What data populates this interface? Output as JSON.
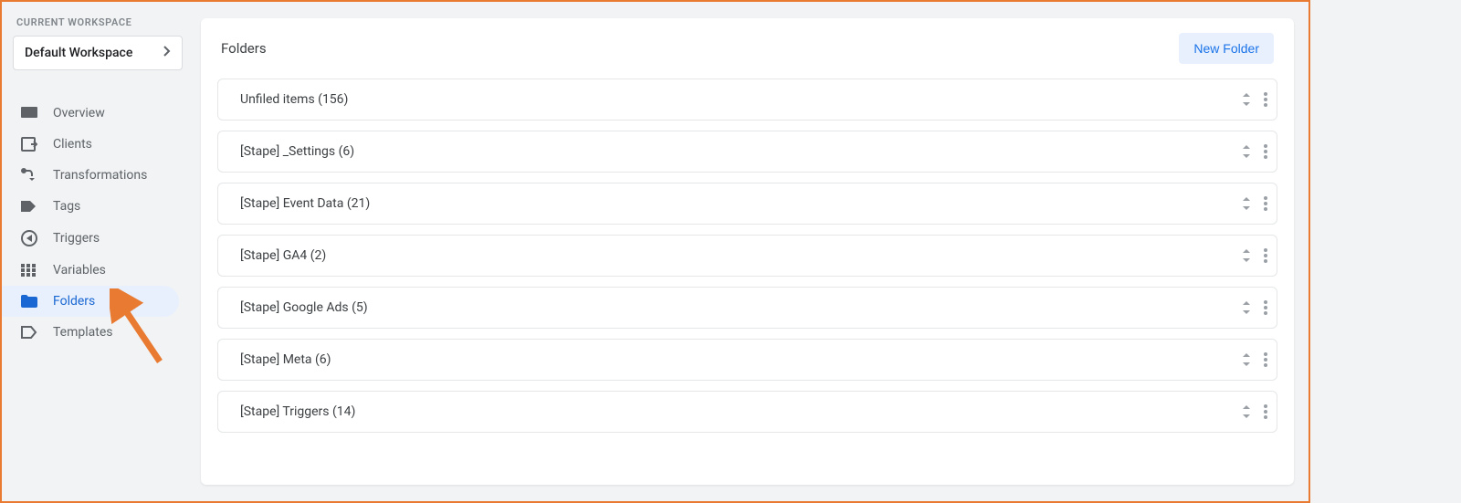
{
  "sidebar": {
    "workspace_section_label": "CURRENT WORKSPACE",
    "workspace_name": "Default Workspace",
    "items": [
      {
        "label": "Overview",
        "icon": "overview"
      },
      {
        "label": "Clients",
        "icon": "clients"
      },
      {
        "label": "Transformations",
        "icon": "transformations"
      },
      {
        "label": "Tags",
        "icon": "tags"
      },
      {
        "label": "Triggers",
        "icon": "triggers"
      },
      {
        "label": "Variables",
        "icon": "variables"
      },
      {
        "label": "Folders",
        "icon": "folders",
        "active": true
      },
      {
        "label": "Templates",
        "icon": "templates"
      }
    ]
  },
  "main": {
    "panel_title": "Folders",
    "new_folder_label": "New Folder",
    "folders": [
      {
        "name": "Unfiled items (156)"
      },
      {
        "name": "[Stape] _Settings (6)"
      },
      {
        "name": "[Stape] Event Data (21)"
      },
      {
        "name": "[Stape] GA4 (2)"
      },
      {
        "name": "[Stape] Google Ads (5)"
      },
      {
        "name": "[Stape] Meta (6)"
      },
      {
        "name": "[Stape] Triggers (14)"
      }
    ]
  }
}
